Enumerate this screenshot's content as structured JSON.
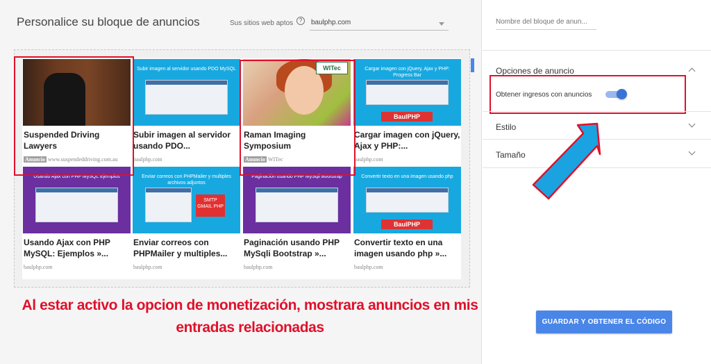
{
  "header": {
    "title": "Personalice su bloque de anuncios",
    "sites_label": "Sus sitios web aptos",
    "help_glyph": "?",
    "site_value": "baulphp.com"
  },
  "preview": {
    "info_glyph": "i",
    "ads": [
      {
        "title": "Suspended Driving Lawyers",
        "badge": "Anuncio",
        "source": "www.suspendeddriving.com.au",
        "thumb": "photo-man"
      },
      {
        "title": "Subir imagen al servidor usando PDO...",
        "source": "baulphp.com",
        "thumb_caption": "Subir imagen al servidor usando PDO MySQL"
      },
      {
        "title": "Raman Imaging Symposium",
        "badge": "Anuncio",
        "source": "WITec",
        "thumb_logo": "WITec"
      },
      {
        "title": "Cargar imagen con jQuery, Ajax y PHP:...",
        "source": "baulphp.com",
        "thumb_caption": "Cargar imagen con jQuery, Ajax y PHP: Progress Bar",
        "thumb_badge": "BaulPHP"
      },
      {
        "title": "Usando Ajax con PHP MySQL: Ejemplos »...",
        "source": "baulphp.com",
        "thumb_caption": "Usando Ajax con PHP MySQL Ejemplos"
      },
      {
        "title": "Enviar correos con PHPMailer y multiples...",
        "source": "baulphp.com",
        "thumb_caption": "Enviar correos con PHPMailer y multiples archivos adjuntos",
        "thumb_badge": "SMTP GMAIL PHP"
      },
      {
        "title": "Paginación usando PHP MySqli Bootstrap »...",
        "source": "baulphp.com",
        "thumb_caption": "Paginación usando PHP MySqli Bootstrap"
      },
      {
        "title": "Convertir texto en una imagen usando php »...",
        "source": "baulphp.com",
        "thumb_caption": "Convertir texto en una imagen usando php",
        "thumb_badge": "BaulPHP"
      }
    ]
  },
  "caption": {
    "line1": "Al estar activo la opcion de monetización, mostrara anuncios en mis",
    "line2": "entradas relacionadas"
  },
  "panel": {
    "name_placeholder": "Nombre del bloque de anun...",
    "sections": {
      "options": "Opciones de anuncio",
      "style": "Estilo",
      "size": "Tamaño"
    },
    "toggle_label": "Obtener ingresos con anuncios",
    "toggle_on": true,
    "save_button": "GUARDAR Y OBTENER EL CÓDIGO"
  },
  "colors": {
    "accent": "#4a86e8",
    "annotation": "#e0102a",
    "arrow": "#1aa3e0"
  }
}
